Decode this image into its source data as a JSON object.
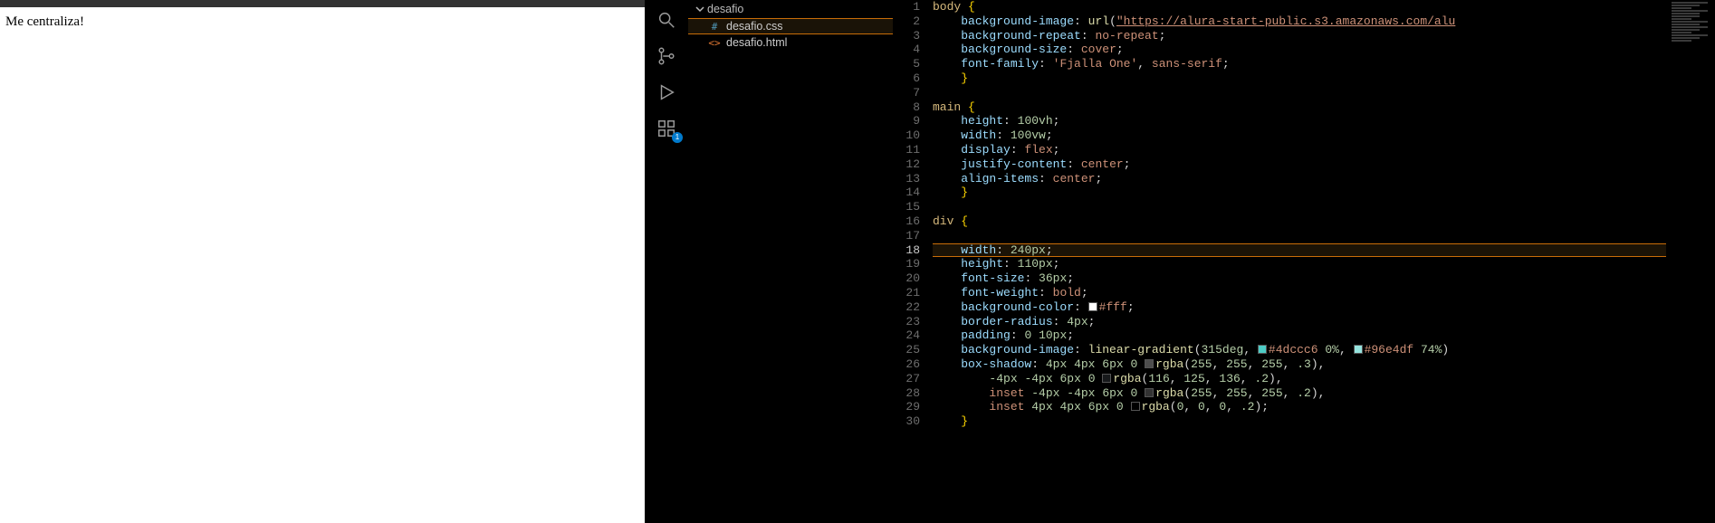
{
  "browser": {
    "text": "Me centraliza!"
  },
  "activity": {
    "search": "search-icon",
    "scm": "source-control-icon",
    "debug": "run-debug-icon",
    "ext": "extensions-icon",
    "ext_badge": "1"
  },
  "explorer": {
    "folder": "desafio",
    "files": [
      {
        "name": "desafio.css",
        "icon": "#",
        "type": "css",
        "selected": true
      },
      {
        "name": "desafio.html",
        "icon": "<>",
        "type": "html",
        "selected": false
      }
    ]
  },
  "editor": {
    "current_line": 18,
    "lines": [
      {
        "n": 1,
        "html": "<span class='sel'>body</span> <span class='brace'>{</span>"
      },
      {
        "n": 2,
        "html": "    <span class='prop'>background-image</span><span class='punc'>: </span><span class='func'>url</span><span class='punc'>(</span><span class='str'>\"https://alura-start-public.s3.amazonaws.com/alu</span>"
      },
      {
        "n": 3,
        "html": "    <span class='prop'>background-repeat</span><span class='punc'>: </span><span class='val'>no-repeat</span><span class='punc'>;</span>"
      },
      {
        "n": 4,
        "html": "    <span class='prop'>background-size</span><span class='punc'>: </span><span class='val'>cover</span><span class='punc'>;</span>"
      },
      {
        "n": 5,
        "html": "    <span class='prop'>font-family</span><span class='punc'>: </span><span class='strp'>'Fjalla One'</span><span class='punc'>, </span><span class='val'>sans-serif</span><span class='punc'>;</span>"
      },
      {
        "n": 6,
        "html": "    <span class='brace'>}</span>"
      },
      {
        "n": 7,
        "html": ""
      },
      {
        "n": 8,
        "html": "<span class='sel'>main</span> <span class='brace'>{</span>"
      },
      {
        "n": 9,
        "html": "    <span class='prop'>height</span><span class='punc'>: </span><span class='num'>100vh</span><span class='punc'>;</span>"
      },
      {
        "n": 10,
        "html": "    <span class='prop'>width</span><span class='punc'>: </span><span class='num'>100vw</span><span class='punc'>;</span>"
      },
      {
        "n": 11,
        "html": "    <span class='prop'>display</span><span class='punc'>: </span><span class='val'>flex</span><span class='punc'>;</span>"
      },
      {
        "n": 12,
        "html": "    <span class='prop'>justify-content</span><span class='punc'>: </span><span class='val'>center</span><span class='punc'>;</span>"
      },
      {
        "n": 13,
        "html": "    <span class='prop'>align-items</span><span class='punc'>: </span><span class='val'>center</span><span class='punc'>;</span>"
      },
      {
        "n": 14,
        "html": "    <span class='brace'>}</span>"
      },
      {
        "n": 15,
        "html": ""
      },
      {
        "n": 16,
        "html": "<span class='sel'>div</span> <span class='brace'>{</span>"
      },
      {
        "n": 17,
        "html": ""
      },
      {
        "n": 18,
        "html": "    <span class='prop'>width</span><span class='punc'>: </span><span class='num'>240px</span><span class='punc'>;</span>"
      },
      {
        "n": 19,
        "html": "    <span class='prop'>height</span><span class='punc'>: </span><span class='num'>110px</span><span class='punc'>;</span>"
      },
      {
        "n": 20,
        "html": "    <span class='prop'>font-size</span><span class='punc'>: </span><span class='num'>36px</span><span class='punc'>;</span>"
      },
      {
        "n": 21,
        "html": "    <span class='prop'>font-weight</span><span class='punc'>: </span><span class='val'>bold</span><span class='punc'>;</span>"
      },
      {
        "n": 22,
        "html": "    <span class='prop'>background-color</span><span class='punc'>: </span><span class='swatch' style='background:#fff'></span><span class='val'>#fff</span><span class='punc'>;</span>"
      },
      {
        "n": 23,
        "html": "    <span class='prop'>border-radius</span><span class='punc'>: </span><span class='num'>4px</span><span class='punc'>;</span>"
      },
      {
        "n": 24,
        "html": "    <span class='prop'>padding</span><span class='punc'>: </span><span class='num'>0</span> <span class='num'>10px</span><span class='punc'>;</span>"
      },
      {
        "n": 25,
        "html": "    <span class='prop'>background-image</span><span class='punc'>: </span><span class='func'>linear-gradient</span><span class='punc'>(</span><span class='num'>315deg</span><span class='punc'>, </span><span class='swatch' style='background:#4dccc6'></span><span class='val'>#4dccc6</span> <span class='num'>0%</span><span class='punc'>, </span><span class='swatch' style='background:#96e4df'></span><span class='val'>#96e4df</span> <span class='num'>74%</span><span class='punc'>)</span>"
      },
      {
        "n": 26,
        "html": "    <span class='prop'>box-shadow</span><span class='punc'>: </span><span class='num'>4px</span> <span class='num'>4px</span> <span class='num'>6px</span> <span class='num'>0</span> <span class='swatch' style='background:rgba(255,255,255,.3)'></span><span class='func'>rgba</span><span class='punc'>(</span><span class='num'>255</span><span class='punc'>, </span><span class='num'>255</span><span class='punc'>, </span><span class='num'>255</span><span class='punc'>, </span><span class='num'>.3</span><span class='punc'>),</span>"
      },
      {
        "n": 27,
        "html": "        <span class='num'>-4px</span> <span class='num'>-4px</span> <span class='num'>6px</span> <span class='num'>0</span> <span class='swatch' style='background:rgba(116,125,136,.2)'></span><span class='func'>rgba</span><span class='punc'>(</span><span class='num'>116</span><span class='punc'>, </span><span class='num'>125</span><span class='punc'>, </span><span class='num'>136</span><span class='punc'>, </span><span class='num'>.2</span><span class='punc'>),</span>"
      },
      {
        "n": 28,
        "html": "        <span class='val'>inset</span> <span class='num'>-4px</span> <span class='num'>-4px</span> <span class='num'>6px</span> <span class='num'>0</span> <span class='swatch' style='background:rgba(255,255,255,.2)'></span><span class='func'>rgba</span><span class='punc'>(</span><span class='num'>255</span><span class='punc'>, </span><span class='num'>255</span><span class='punc'>, </span><span class='num'>255</span><span class='punc'>, </span><span class='num'>.2</span><span class='punc'>),</span>"
      },
      {
        "n": 29,
        "html": "        <span class='val'>inset</span> <span class='num'>4px</span> <span class='num'>4px</span> <span class='num'>6px</span> <span class='num'>0</span> <span class='swatch' style='background:rgba(0,0,0,.2)'></span><span class='func'>rgba</span><span class='punc'>(</span><span class='num'>0</span><span class='punc'>, </span><span class='num'>0</span><span class='punc'>, </span><span class='num'>0</span><span class='punc'>, </span><span class='num'>.2</span><span class='punc'>);</span>"
      },
      {
        "n": 30,
        "html": "    <span class='brace'>}</span>"
      }
    ]
  }
}
